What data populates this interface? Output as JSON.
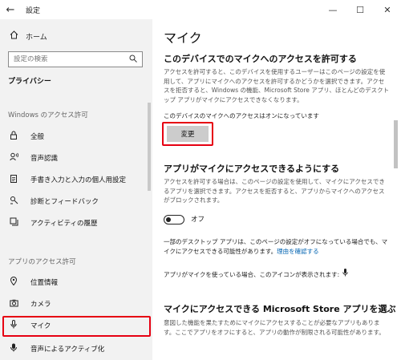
{
  "window": {
    "title": "設定",
    "back_icon": "←",
    "minimize_icon": "—",
    "maximize_icon": "☐",
    "close_icon": "✕"
  },
  "sidebar": {
    "home_label": "ホーム",
    "search_placeholder": "設定の検索",
    "section_title": "プライバシー",
    "groups": [
      {
        "label": "Windows のアクセス許可",
        "items": [
          {
            "label": "全般",
            "icon": "lock-icon"
          },
          {
            "label": "音声認識",
            "icon": "speech-icon"
          },
          {
            "label": "手書き入力と入力の個人用設定",
            "icon": "clipboard-icon"
          },
          {
            "label": "診断とフィードバック",
            "icon": "feedback-icon"
          },
          {
            "label": "アクティビティの履歴",
            "icon": "history-icon"
          }
        ]
      },
      {
        "label": "アプリのアクセス許可",
        "items": [
          {
            "label": "位置情報",
            "icon": "location-icon"
          },
          {
            "label": "カメラ",
            "icon": "camera-icon"
          },
          {
            "label": "マイク",
            "icon": "microphone-icon",
            "selected": true
          },
          {
            "label": "音声によるアクティブ化",
            "icon": "voice-activation-icon"
          }
        ]
      }
    ]
  },
  "main": {
    "title": "マイク",
    "section1": {
      "heading": "このデバイスでのマイクへのアクセスを許可する",
      "description": "アクセスを許可すると、このデバイスを使用するユーザーはこのページの設定を使用して、アプリにマイクへのアクセスを許可するかどうかを選択できます。アクセスを拒否すると、Windows の機能、Microsoft Store アプリ、ほとんどのデスクトップ アプリがマイクにアクセスできなくなります。",
      "status": "このデバイスのマイクへのアクセスはオンになっています",
      "change_button": "変更"
    },
    "section2": {
      "heading": "アプリがマイクにアクセスできるようにする",
      "description": "アクセスを許可する場合は、このページの設定を使用して、マイクにアクセスできるアプリを選択できます。アクセスを拒否すると、アプリからマイクへのアクセスがブロックされます。",
      "toggle_label": "オフ",
      "toggle_state": "off",
      "desktop_note": "一部のデスクトップ アプリは、このページの設定がオフになっている場合でも、マイクにアクセスできる可能性があります。",
      "link": "理由を確認する",
      "icon_note": "アプリがマイクを使っている場合、このアイコンが表示されます:"
    },
    "section3": {
      "heading": "マイクにアクセスできる Microsoft Store アプリを選ぶ",
      "description": "意図した機能を果たすためにマイクにアクセスすることが必要なアプリもあります。ここでアプリをオフにすると、アプリの動作が制限される可能性があります。"
    }
  },
  "colors": {
    "highlight": "#e60012",
    "sidebar_bg": "#f2f2f2",
    "link": "#0063b1",
    "button_bg": "#cccccc"
  }
}
